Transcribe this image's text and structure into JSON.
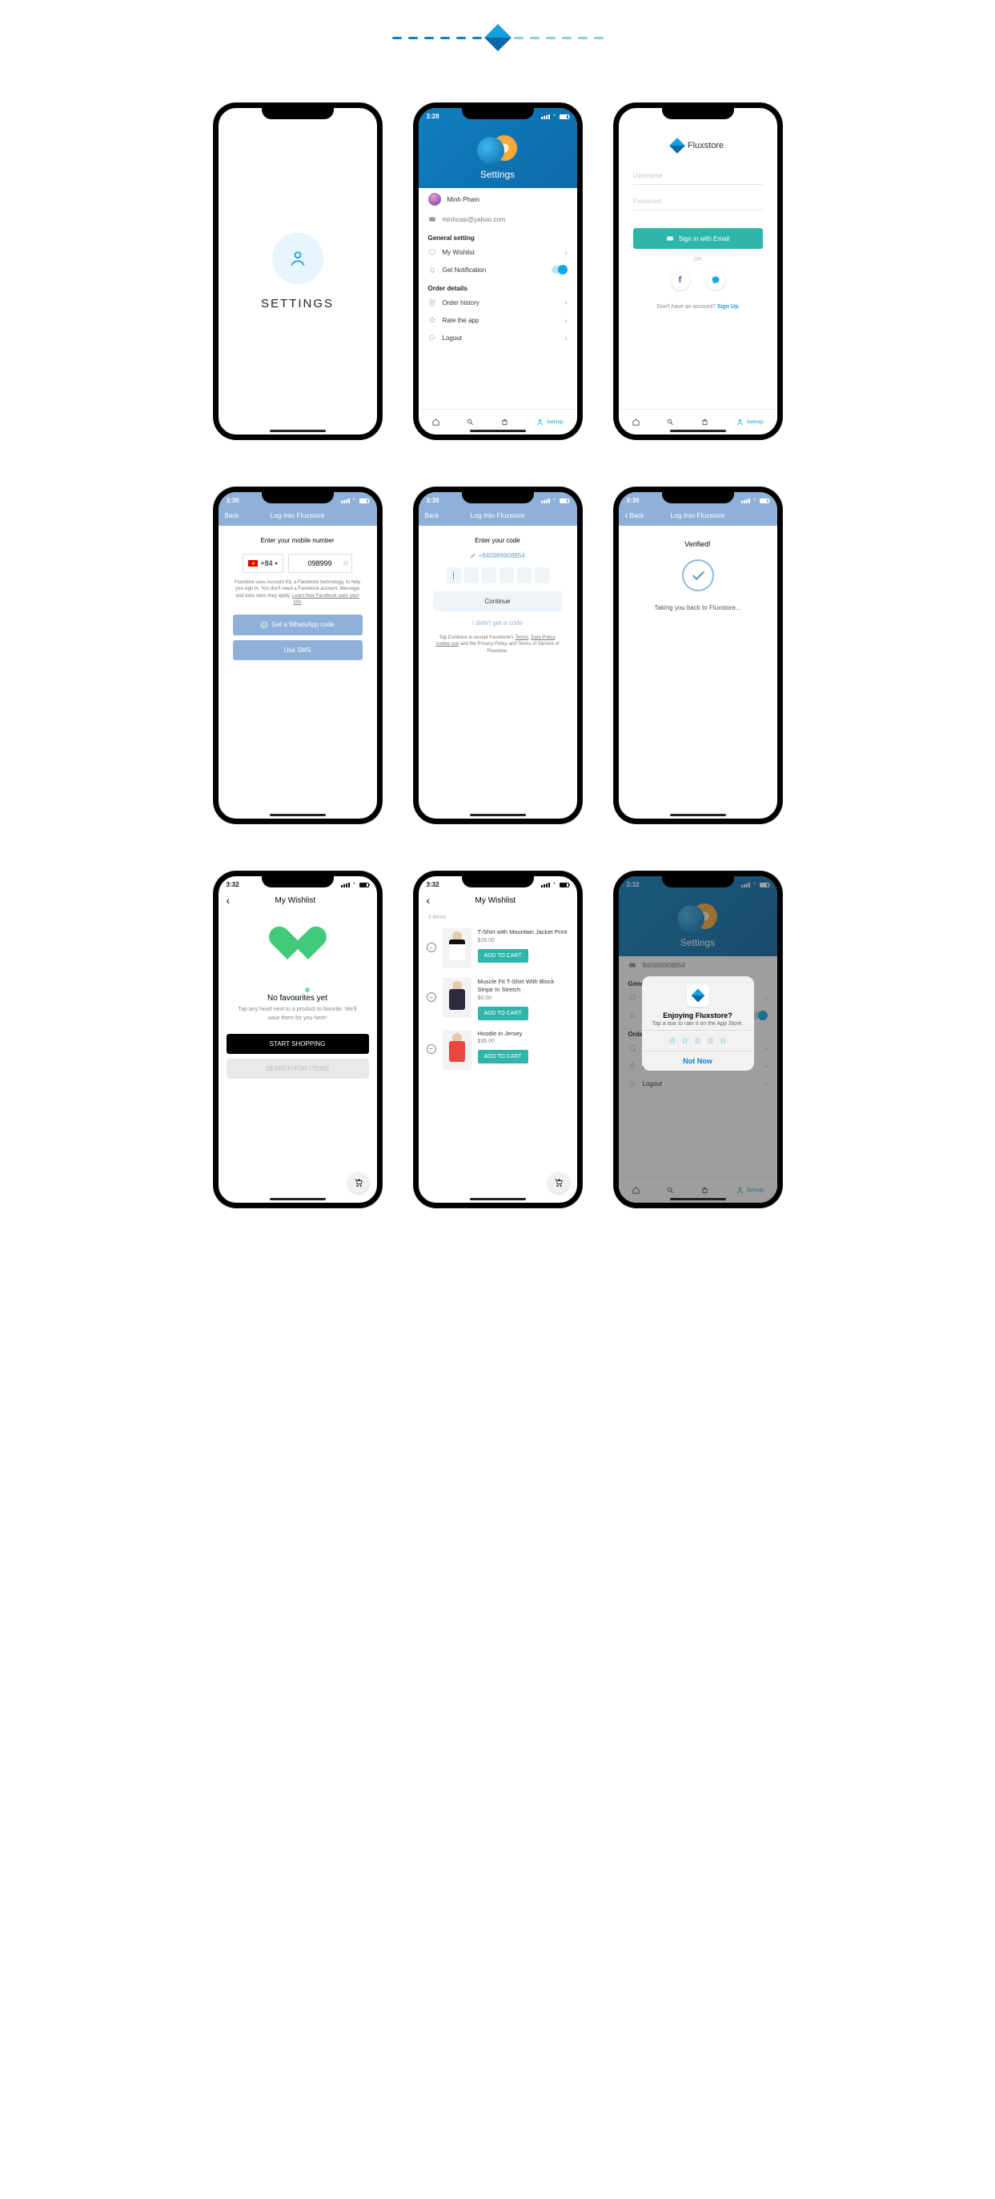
{
  "appName": "Fluxstore",
  "s1": {
    "label": "SETTINGS"
  },
  "s2": {
    "time": "3:28",
    "headerTitle": "Settings",
    "user": {
      "name": "Minh Pham",
      "email": "minhcasi@yahoo.com"
    },
    "section1": "General setting",
    "item_wishlist": "My Wishlist",
    "item_notif": "Get Notification",
    "section2": "Order details",
    "item_orderhist": "Order history",
    "item_rate": "Rate the app",
    "item_logout": "Logout",
    "tab_settings": "Settings"
  },
  "s3": {
    "username_ph": "Username",
    "password_ph": "Password",
    "signin": "Sign in with Email",
    "or": "OR",
    "noacct": "Don't have an account? ",
    "signup": "Sign Up",
    "tab_settings": "Settings"
  },
  "s4": {
    "time": "3:30",
    "back": "Back",
    "title": "Log Into Fluxstore",
    "prompt": "Enter your mobile number",
    "code": "+84",
    "number": "098999",
    "fine": "Fluxstore uses Account Kit, a Facebook technology, to help you sign in. You don't need a Facebook account. Message and data rates may apply. ",
    "learn": "Learn how Facebook uses your info",
    "btn_wa": "Get a WhatsApp code",
    "btn_sms": "Use SMS"
  },
  "s5": {
    "time": "3:30",
    "back": "Back",
    "title": "Log Into Fluxstore",
    "prompt": "Enter your code",
    "phone": "+840989908854",
    "continue": "Continue",
    "nocode": "I didn't get a code",
    "fine1": "Tap Continue to accept Facebook's ",
    "terms": "Terms",
    "comma": ", ",
    "datapolicy": "Data Policy",
    "comma2": ", ",
    "cookie": "cookie use",
    "fine2": " and the Privacy Policy and Terms of Service of Fluxstore."
  },
  "s6": {
    "time": "3:30",
    "back": "Back",
    "title": "Log Into Fluxstore",
    "verified": "Verified!",
    "msg": "Taking you back to Fluxstore..."
  },
  "s7": {
    "time": "3:32",
    "title": "My Wishlist",
    "h": "No favourites yet",
    "sub": "Tap any heart next to a product to favorite. We'll save them for you here!",
    "start": "START SHOPPING",
    "search": "SEARCH FOR ITEMS"
  },
  "s8": {
    "time": "3:32",
    "title": "My Wishlist",
    "count": "3 items",
    "items": [
      {
        "name": "T-Shirt with Mountain Jacket Print",
        "price": "$28.00",
        "btn": "ADD TO CART",
        "color": "#fff",
        "band": "#111"
      },
      {
        "name": "Muscle Fit T-Shirt With Block Stripe In Stretch",
        "price": "$0.00",
        "btn": "ADD TO CART",
        "color": "#2b2b3d",
        "band": ""
      },
      {
        "name": "Hoodie in Jersey",
        "price": "$35.00",
        "btn": "ADD TO CART",
        "color": "#e8473f",
        "band": ""
      }
    ]
  },
  "s9": {
    "time": "3:32",
    "headerTitle": "Settings",
    "email": "840989908854",
    "section1": "General setting",
    "item_wishlist": "My Wishlist",
    "item_notif": "Get Notification",
    "section2": "Order details",
    "item_orderhist": "Order history",
    "item_rate": "Rate the app",
    "item_logout": "Logout",
    "tab_settings": "Settings",
    "modal": {
      "title": "Enjoying Fluxstore?",
      "sub": "Tap a star to rate it on the App Store.",
      "notnow": "Not Now"
    }
  }
}
